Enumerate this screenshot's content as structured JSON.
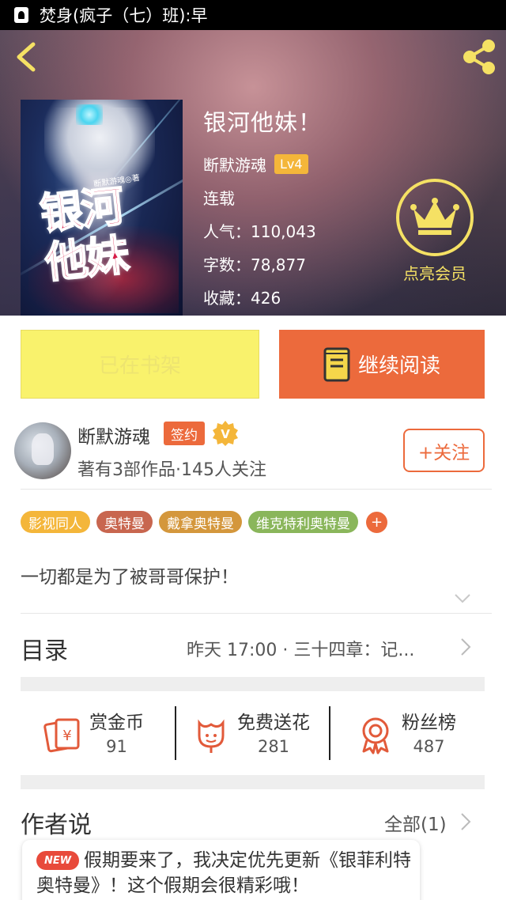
{
  "status_bar": {
    "title": "焚身(疯子（七）班):早"
  },
  "book": {
    "title": "银河他妹！",
    "author": "断默游魂",
    "level": "Lv4",
    "status": "连载",
    "popularity": "人气：110,043",
    "word_count": "字数：78,877",
    "favorites": "收藏：426",
    "cover_title_line1": "银河",
    "cover_title_line2": "他妹",
    "cover_author": "断默游魂◎著"
  },
  "vip": {
    "label": "点亮会员"
  },
  "actions": {
    "shelf_label": "已在书架",
    "read_label": "继续阅读"
  },
  "author_card": {
    "name": "断默游魂",
    "sign_badge": "签约",
    "verified_mark": "V",
    "meta": "著有3部作品·145人关注",
    "follow_label": "+关注"
  },
  "tags": [
    {
      "label": "影视同人",
      "color": "#f4b63a"
    },
    {
      "label": "奥特曼",
      "color": "#c8664f"
    },
    {
      "label": "戴拿奥特曼",
      "color": "#d4973c"
    },
    {
      "label": "维克特利奥特曼",
      "color": "#8ab65b"
    }
  ],
  "tag_more": "+",
  "description": "一切都是为了被哥哥保护！",
  "catalog": {
    "label": "目录",
    "latest": "昨天 17:00 · 三十四章：记..."
  },
  "stats": [
    {
      "icon": "reward-coin-icon",
      "label": "赏金币",
      "value": "91"
    },
    {
      "icon": "flower-icon",
      "label": "免费送花",
      "value": "281"
    },
    {
      "icon": "fan-ribbon-icon",
      "label": "粉丝榜",
      "value": "487"
    }
  ],
  "author_says": {
    "label": "作者说",
    "all_label": "全部(1)",
    "new_badge": "NEW",
    "note": "假期要来了，我决定优先更新《银菲利特奥特曼》！这个假期会很精彩哦！"
  },
  "colors": {
    "accent": "#ec6a3c",
    "shelf_button": "#f9f26c",
    "vip_gold": "#f5e164"
  }
}
